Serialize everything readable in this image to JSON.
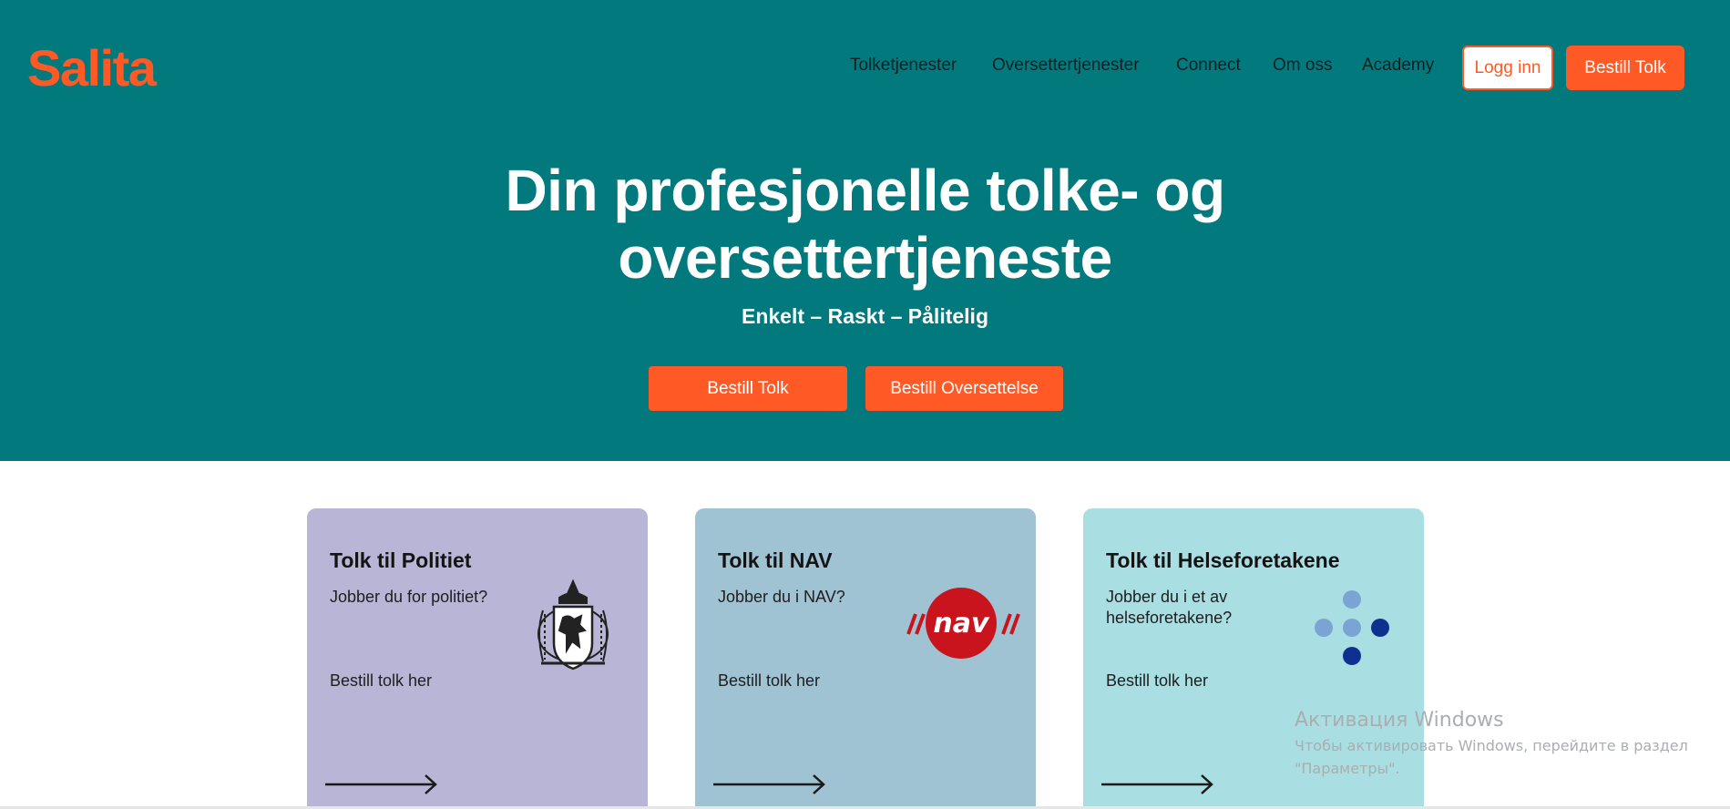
{
  "brand": {
    "logo_text": "Salita",
    "accent": "#ff5a26",
    "hero_bg": "#027a7d"
  },
  "nav": {
    "items": [
      "Tolketjenester",
      "Oversettertjenester",
      "Connect",
      "Om oss",
      "Academy"
    ],
    "login_label": "Logg inn",
    "order_label": "Bestill Tolk"
  },
  "hero": {
    "title_line1": "Din profesjonelle tolke- og",
    "title_line2": "oversettertjeneste",
    "subtitle": "Enkelt – Raskt – Pålitelig",
    "btn_order_interpreter": "Bestill Tolk",
    "btn_order_translation": "Bestill Oversettelse"
  },
  "cards": [
    {
      "title": "Tolk til Politiet",
      "question": "Jobber du for politiet?",
      "link": "Bestill tolk her",
      "bg": "#b8b5d6",
      "icon": "police-crest-icon"
    },
    {
      "title": "Tolk til NAV",
      "question": "Jobber du i NAV?",
      "link": "Bestill tolk her",
      "bg": "#a0c3d4",
      "icon": "nav-logo-icon"
    },
    {
      "title": "Tolk til Helseforetakene",
      "question": "Jobber du i et av helseforetakene?",
      "link": "Bestill tolk her",
      "bg": "#a9dee2",
      "icon": "health-dots-icon"
    }
  ],
  "os_overlay": {
    "title": "Активация Windows",
    "line1": "Чтобы активировать Windows, перейдите в раздел",
    "line2": "\"Параметры\"."
  }
}
